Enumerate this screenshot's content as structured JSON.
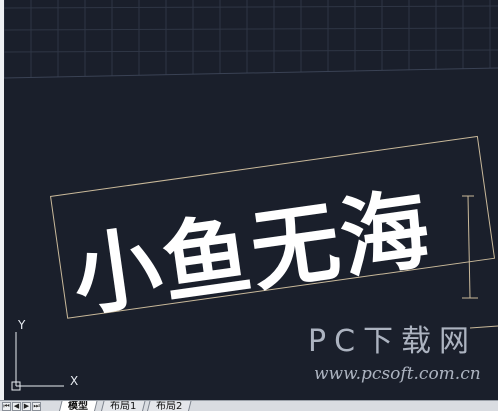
{
  "drawing": {
    "text": "小鱼无海"
  },
  "ucs": {
    "x_label": "X",
    "y_label": "Y"
  },
  "watermark": {
    "title": "PC下载网",
    "url": "www.pcsoft.com.cn"
  },
  "layout_tabs": [
    {
      "label": "模型",
      "active": true
    },
    {
      "label": "布局1",
      "active": false
    },
    {
      "label": "布局2",
      "active": false
    }
  ],
  "tab_nav": {
    "first": "⏮",
    "prev": "◀",
    "next": "▶",
    "last": "⏭"
  },
  "colors": {
    "background": "#1a1f2b",
    "grid": "#2f3645",
    "text": "#ffffff",
    "selection": "#c9b99a"
  }
}
